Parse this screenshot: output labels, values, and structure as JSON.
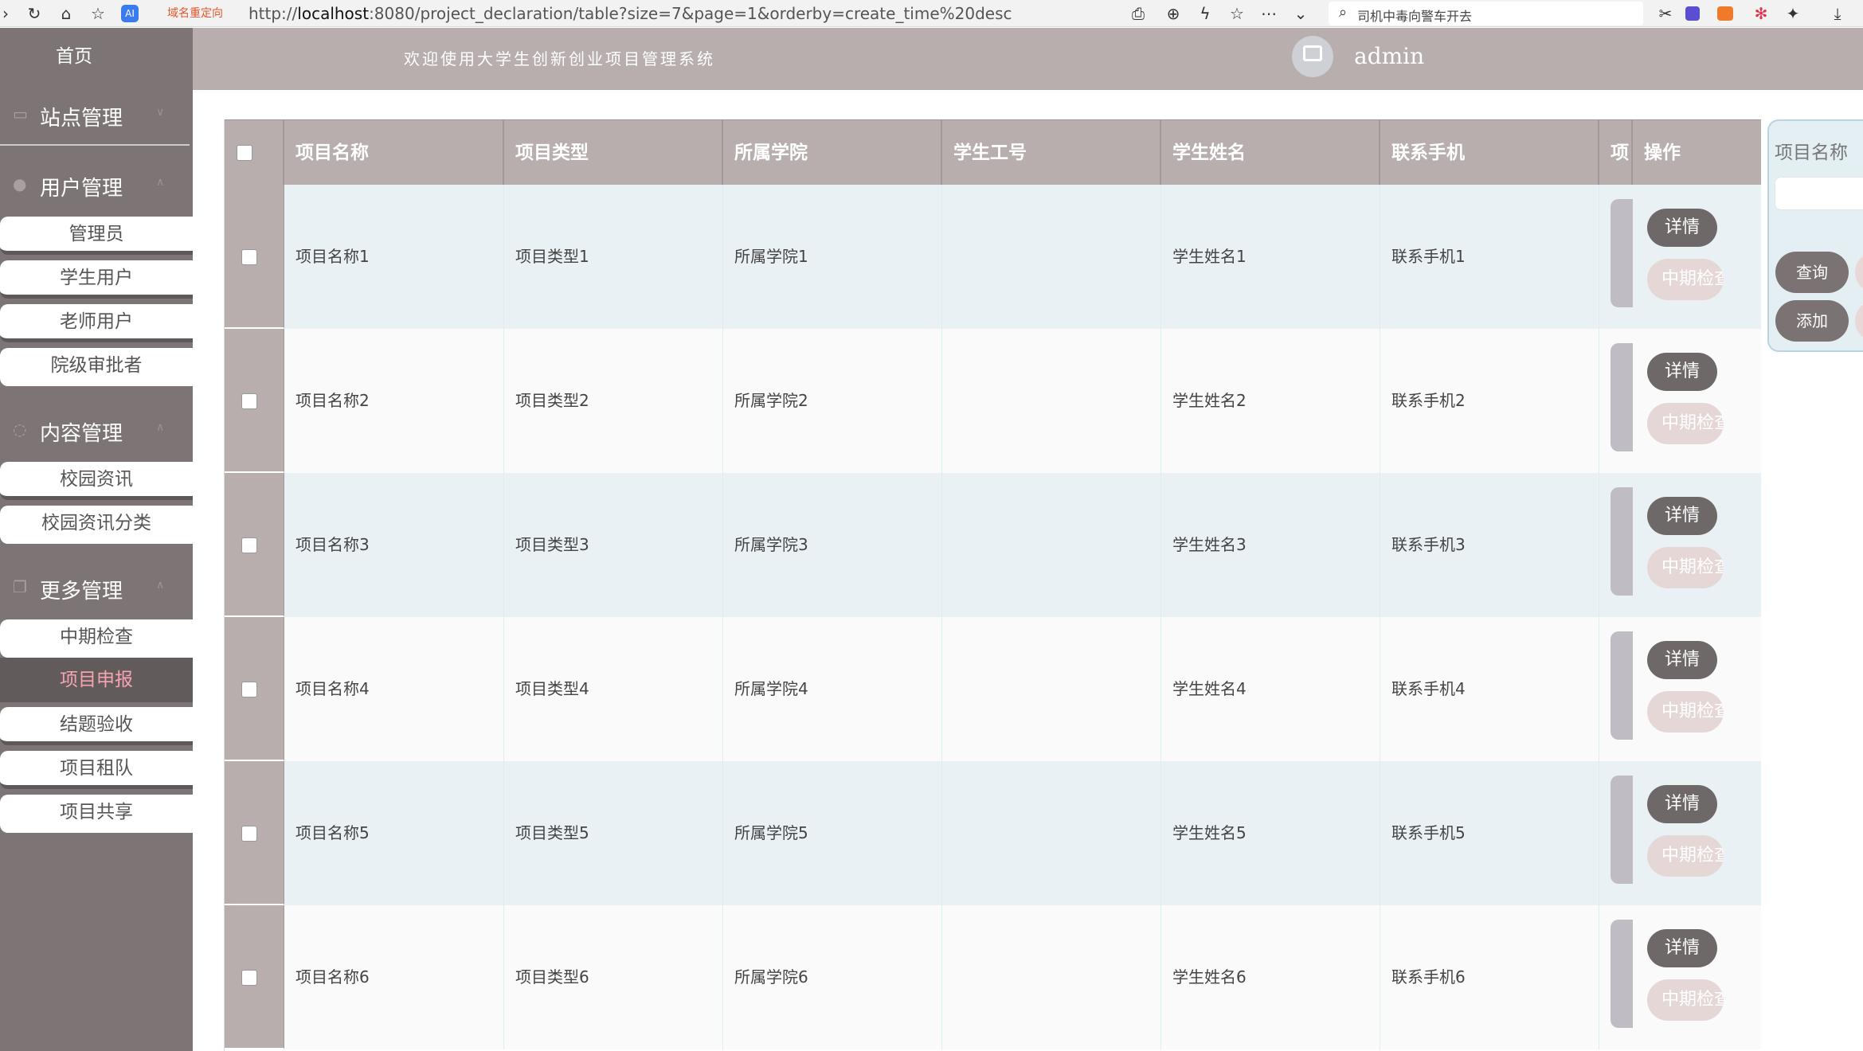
{
  "browser": {
    "redirect_tag": "域名重定向",
    "url_prefix": "http://",
    "url_host": "localhost",
    "url_rest": ":8080/project_declaration/table?size=7&page=1&orderby=create_time%20desc",
    "search_text": "司机中毒向警车开去",
    "ai_badge": "AI"
  },
  "sidebar": {
    "home": "首页",
    "groups": [
      {
        "label": "站点管理",
        "items": []
      },
      {
        "label": "用户管理",
        "items": [
          "管理员",
          "学生用户",
          "老师用户",
          "院级审批者"
        ]
      },
      {
        "label": "内容管理",
        "items": [
          "校园资讯",
          "校园资讯分类"
        ]
      },
      {
        "label": "更多管理",
        "items": [
          "中期检查",
          "项目申报",
          "结题验收",
          "项目租队",
          "项目共享"
        ]
      }
    ],
    "active_item": "项目申报"
  },
  "header": {
    "welcome": "欢迎使用大学生创新创业项目管理系统",
    "username": "admin"
  },
  "table": {
    "columns": [
      "项目名称",
      "项目类型",
      "所属学院",
      "学生工号",
      "学生姓名",
      "联系手机",
      "项",
      "操作"
    ],
    "rows": [
      {
        "name": "项目名称1",
        "type": "项目类型1",
        "college": "所属学院1",
        "student_id": "",
        "student_name": "学生姓名1",
        "phone": "联系手机1"
      },
      {
        "name": "项目名称2",
        "type": "项目类型2",
        "college": "所属学院2",
        "student_id": "",
        "student_name": "学生姓名2",
        "phone": "联系手机2"
      },
      {
        "name": "项目名称3",
        "type": "项目类型3",
        "college": "所属学院3",
        "student_id": "",
        "student_name": "学生姓名3",
        "phone": "联系手机3"
      },
      {
        "name": "项目名称4",
        "type": "项目类型4",
        "college": "所属学院4",
        "student_id": "",
        "student_name": "学生姓名4",
        "phone": "联系手机4"
      },
      {
        "name": "项目名称5",
        "type": "项目类型5",
        "college": "所属学院5",
        "student_id": "",
        "student_name": "学生姓名5",
        "phone": "联系手机5"
      },
      {
        "name": "项目名称6",
        "type": "项目类型6",
        "college": "所属学院6",
        "student_id": "",
        "student_name": "学生姓名6",
        "phone": "联系手机6"
      }
    ],
    "detail_label": "详情",
    "midterm_label": "中期检查"
  },
  "search_panel": {
    "label": "项目名称",
    "input_value": "",
    "query_label": "查询",
    "add_label": "添加"
  },
  "colors": {
    "sidebar_bg": "#7d7575",
    "header_bg": "#b8aeae",
    "active_text": "#f7a4b0",
    "row_alt": "#e9f1f5"
  }
}
